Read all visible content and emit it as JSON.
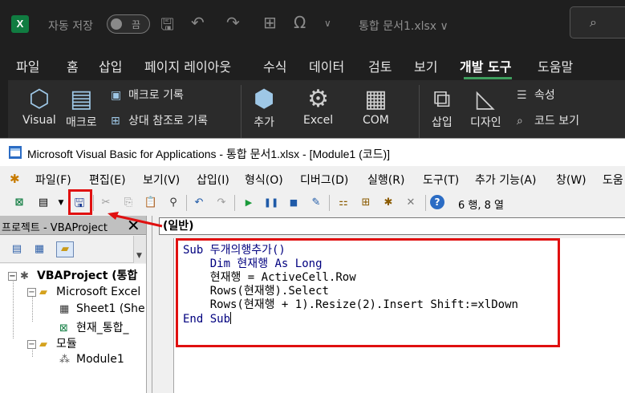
{
  "excel": {
    "autosave_label": "자동 저장",
    "autosave_state": "끔",
    "filename": "통합 문서1.xlsx ∨",
    "tabs": [
      "파일",
      "홈",
      "삽입",
      "페이지 레이아웃",
      "수식",
      "데이터",
      "검토",
      "보기",
      "개발 도구",
      "도움말"
    ],
    "active_tab": "개발 도구",
    "ribbon": {
      "visual": "Visual",
      "macro": "매크로",
      "record_macro": "매크로 기록",
      "relative_ref": "상대 참조로 기록",
      "addins": "추가",
      "excel": "Excel",
      "com": "COM",
      "insert": "삽입",
      "design": "디자인",
      "properties": "속성",
      "view_code": "코드 보기"
    },
    "accent_color": "#107c41"
  },
  "vbe": {
    "title": "Microsoft Visual Basic for Applications - 통합 문서1.xlsx - [Module1 (코드)]",
    "menu": [
      "파일(F)",
      "편집(E)",
      "보기(V)",
      "삽입(I)",
      "형식(O)",
      "디버그(D)",
      "실행(R)",
      "도구(T)",
      "추가 기능(A)",
      "창(W)",
      "도움"
    ],
    "position": "6 행, 8 열",
    "project_pane_title": "프로젝트 - VBAProject",
    "tree": {
      "root": "VBAProject (통합",
      "excel_objects": "Microsoft Excel",
      "sheet1": "Sheet1 (She",
      "thisworkbook": "현재_통합_",
      "modules": "모듈",
      "module1": "Module1"
    },
    "combo": "(일반)",
    "code": [
      "Sub 두개의행추가()",
      "    Dim 현재행 As Long",
      "    현재행 = ActiveCell.Row",
      "    Rows(현재행).Select",
      "    Rows(현재행 + 1).Resize(2).Insert Shift:=xlDown",
      "End Sub"
    ],
    "highlight_color": "#e01010"
  }
}
